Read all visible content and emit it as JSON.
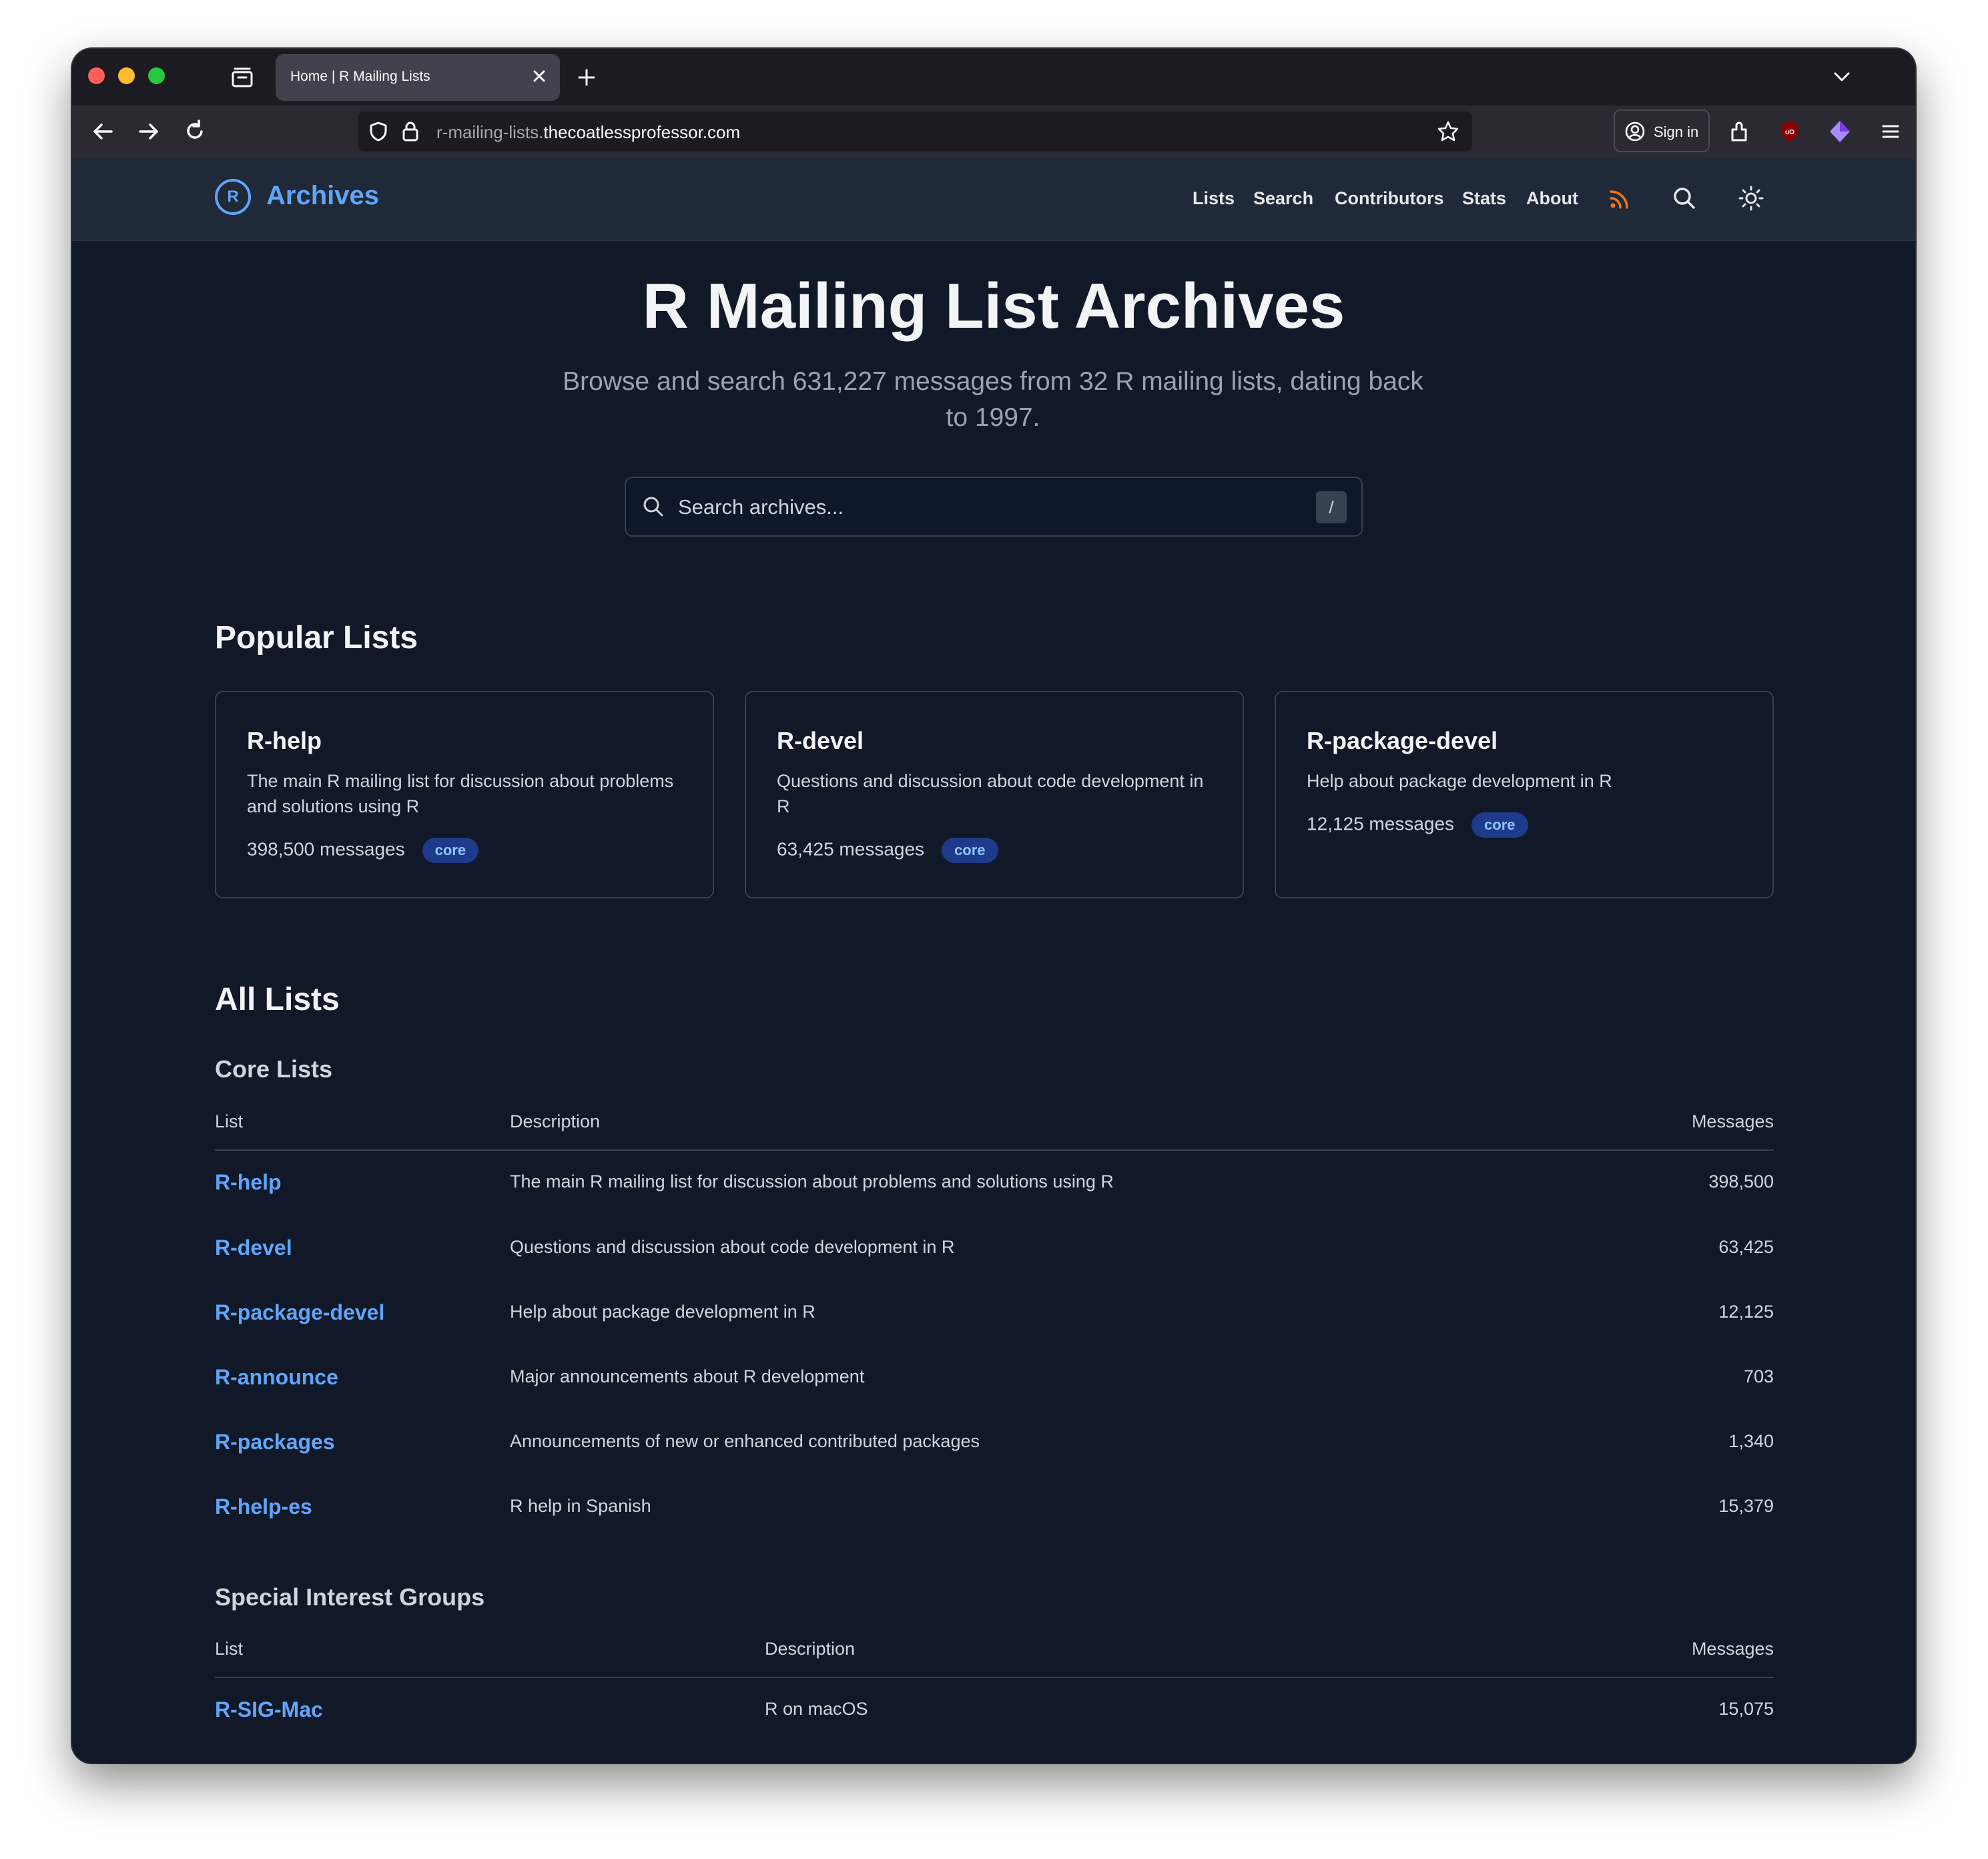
{
  "browser": {
    "tab_title": "Home | R Mailing Lists",
    "url_prefix": "r-mailing-lists.",
    "url_domain": "thecoatlessprofessor.com",
    "sign_in_label": "Sign in"
  },
  "site": {
    "logo_letter": "R",
    "logo_text": "Archives",
    "nav": [
      "Lists",
      "Search",
      "Contributors",
      "Stats",
      "About"
    ],
    "accent_color": "#60a5fa",
    "rss_color": "#f97316"
  },
  "hero": {
    "title": "R Mailing List Archives",
    "subtitle": "Browse and search 631,227 messages from 32 R mailing lists, dating back to 1997.",
    "search_placeholder": "Search archives...",
    "search_shortcut": "/"
  },
  "popular": {
    "heading": "Popular Lists",
    "cards": [
      {
        "title": "R-help",
        "desc": "The main R mailing list for discussion about problems and solutions using R",
        "messages": "398,500 messages",
        "badge": "core"
      },
      {
        "title": "R-devel",
        "desc": "Questions and discussion about code development in R",
        "messages": "63,425 messages",
        "badge": "core"
      },
      {
        "title": "R-package-devel",
        "desc": "Help about package development in R",
        "messages": "12,125 messages",
        "badge": "core"
      }
    ]
  },
  "all_lists": {
    "heading": "All Lists",
    "core": {
      "heading": "Core Lists",
      "columns": [
        "List",
        "Description",
        "Messages"
      ],
      "rows": [
        {
          "name": "R-help",
          "desc": "The main R mailing list for discussion about problems and solutions using R",
          "count": "398,500"
        },
        {
          "name": "R-devel",
          "desc": "Questions and discussion about code development in R",
          "count": "63,425"
        },
        {
          "name": "R-package-devel",
          "desc": "Help about package development in R",
          "count": "12,125"
        },
        {
          "name": "R-announce",
          "desc": "Major announcements about R development",
          "count": "703"
        },
        {
          "name": "R-packages",
          "desc": "Announcements of new or enhanced contributed packages",
          "count": "1,340"
        },
        {
          "name": "R-help-es",
          "desc": "R help in Spanish",
          "count": "15,379"
        }
      ]
    },
    "sig": {
      "heading": "Special Interest Groups",
      "columns": [
        "List",
        "Description",
        "Messages"
      ],
      "rows": [
        {
          "name": "R-SIG-Mac",
          "desc": "R on macOS",
          "count": "15,075"
        }
      ]
    }
  }
}
